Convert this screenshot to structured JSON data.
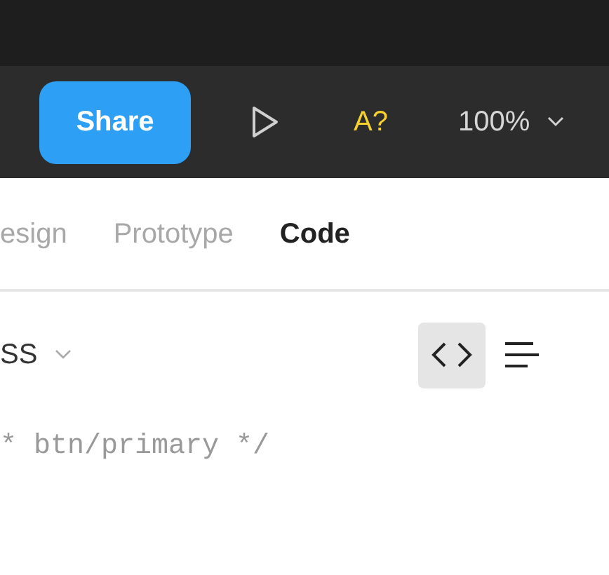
{
  "toolbar": {
    "share_button": "Share",
    "font_badge": "A?",
    "zoom": "100%"
  },
  "tabs": [
    {
      "label": "esign",
      "selected": false
    },
    {
      "label": "Prototype",
      "selected": false
    },
    {
      "label": "Code",
      "selected": true
    }
  ],
  "language_dropdown": "SS",
  "view_modes": [
    {
      "kind": "code",
      "selected": true
    },
    {
      "kind": "list",
      "selected": false
    }
  ],
  "code_line": "* btn/primary */"
}
